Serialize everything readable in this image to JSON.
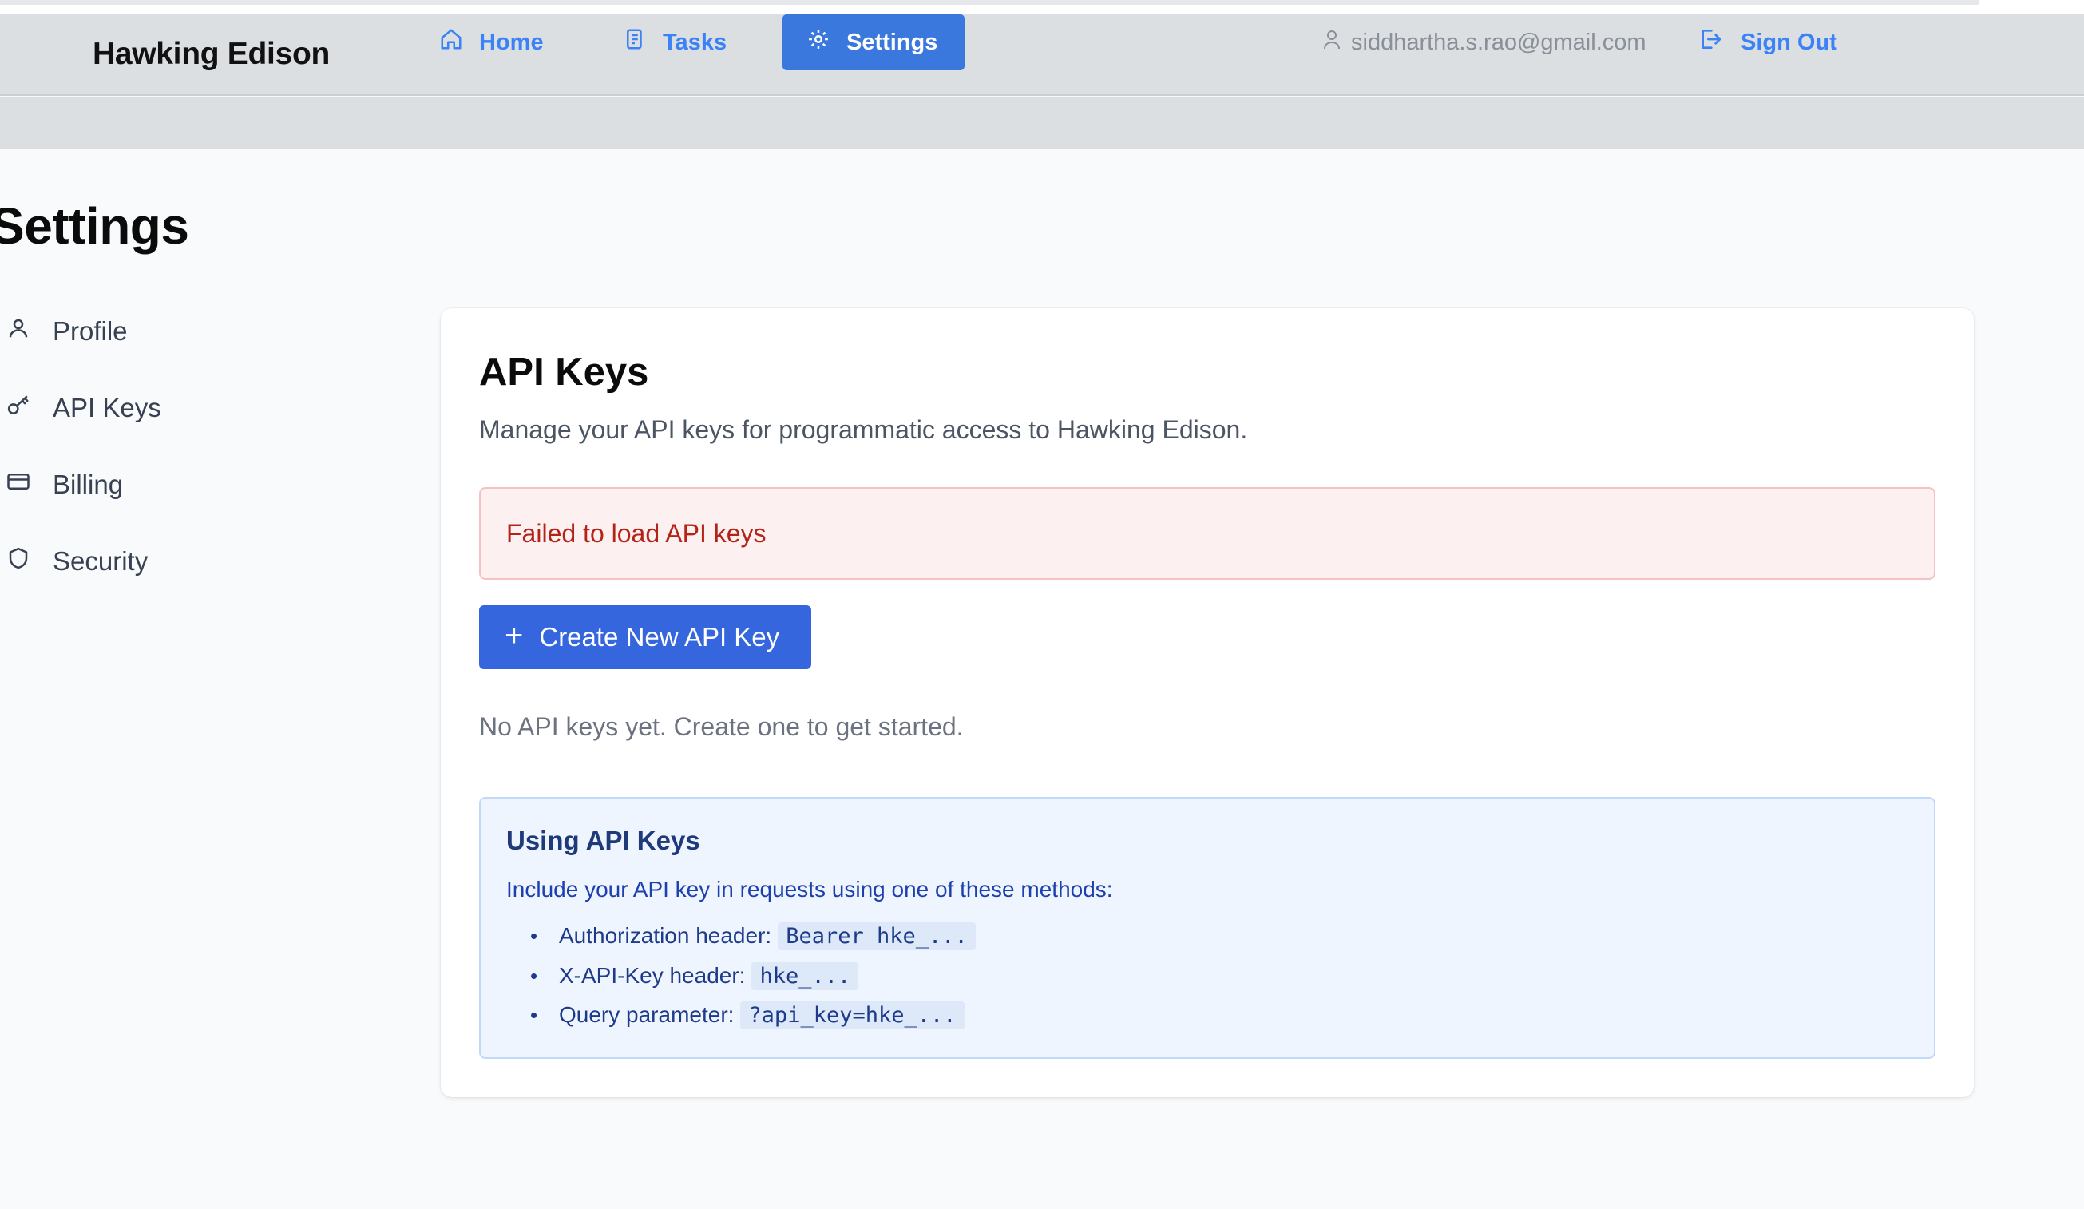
{
  "app": {
    "brand": "Hawking Edison"
  },
  "nav": {
    "home": "Home",
    "tasks": "Tasks",
    "settings": "Settings",
    "user_email": "siddhartha.s.rao@gmail.com",
    "sign_out": "Sign Out"
  },
  "page": {
    "title": "Settings"
  },
  "sidebar": {
    "items": [
      {
        "label": "Profile",
        "icon": "user-icon"
      },
      {
        "label": "API Keys",
        "icon": "key-icon"
      },
      {
        "label": "Billing",
        "icon": "credit-card-icon"
      },
      {
        "label": "Security",
        "icon": "shield-icon"
      }
    ]
  },
  "api_keys": {
    "title": "API Keys",
    "description": "Manage your API keys for programmatic access to Hawking Edison.",
    "error": "Failed to load API keys",
    "create_button": "Create New API Key",
    "create_icon": "+",
    "empty_state": "No API keys yet. Create one to get started.",
    "usage": {
      "title": "Using API Keys",
      "intro": "Include your API key in requests using one of these methods:",
      "methods": [
        {
          "label": "Authorization header:",
          "code": "Bearer hke_..."
        },
        {
          "label": "X-API-Key header:",
          "code": "hke_..."
        },
        {
          "label": "Query parameter:",
          "code": "?api_key=hke_..."
        }
      ]
    }
  },
  "colors": {
    "accent": "#3a78de",
    "primary_button": "#3566de",
    "error_text": "#b42318",
    "error_bg": "#fdf0f0",
    "info_bg": "#eef5fe"
  }
}
